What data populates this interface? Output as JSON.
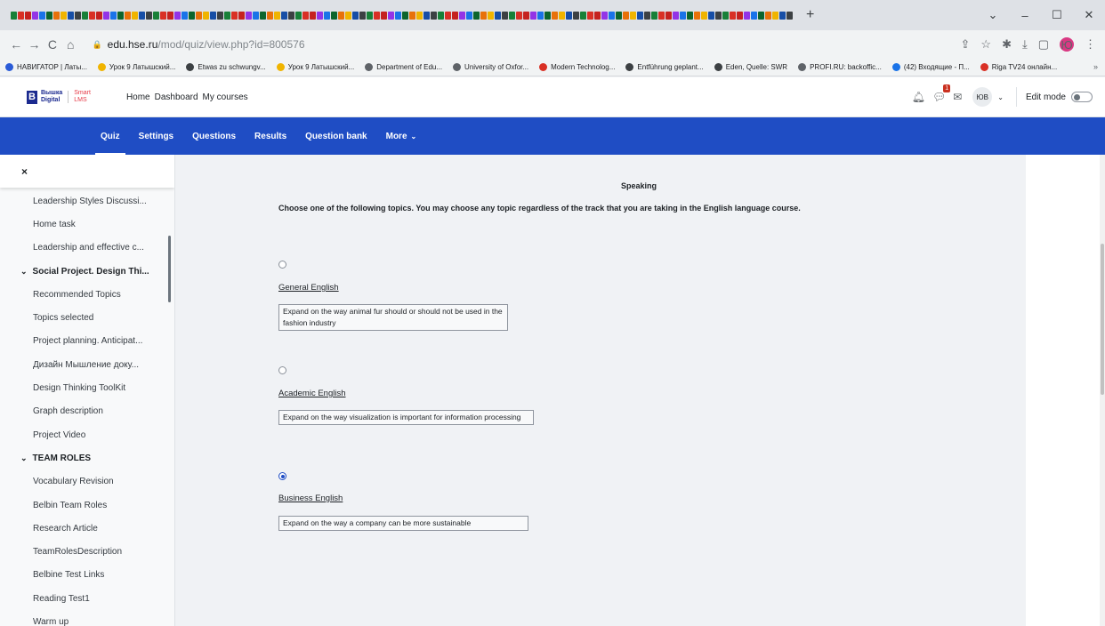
{
  "browser": {
    "new_tab": "+",
    "window_controls": [
      "⌄",
      "–",
      "☐",
      "✕"
    ],
    "nav": [
      "←",
      "→",
      "C",
      "⌂"
    ],
    "url_host": "edu.hse.ru",
    "url_path": "/mod/quiz/view.php?id=800576",
    "bookmarks": [
      {
        "label": "НАВИГАТОР | Латы...",
        "color": "#2a5bd7"
      },
      {
        "label": "Урок 9 Латышский...",
        "color": "#f0b400"
      },
      {
        "label": "Etwas zu schwungv...",
        "color": "#3c4043"
      },
      {
        "label": "Урок 9 Латышский...",
        "color": "#f0b400"
      },
      {
        "label": "Department of Edu...",
        "color": "#5f6368"
      },
      {
        "label": "University of Oxfor...",
        "color": "#5f6368"
      },
      {
        "label": "Modern Technolog...",
        "color": "#d93025"
      },
      {
        "label": "Entführung geplant...",
        "color": "#3c4043"
      },
      {
        "label": "Eden, Quelle: SWR",
        "color": "#3c4043"
      },
      {
        "label": "PROFI.RU: backoffic...",
        "color": "#5f6368"
      },
      {
        "label": "(42) Входящие - П...",
        "color": "#1a73e8"
      },
      {
        "label": "Riga TV24 онлайн...",
        "color": "#d93025"
      }
    ],
    "bookmarks_more": "»",
    "profile_initials": "Ю"
  },
  "header": {
    "logo_line1": "Вышка",
    "logo_line2": "Digital",
    "logo_smart": "Smart",
    "logo_lms": "LMS",
    "nav": [
      "Home",
      "Dashboard",
      "My courses"
    ],
    "message_badge": "1",
    "user_initials": "ЮВ",
    "edit_mode_label": "Edit mode"
  },
  "secondary_nav": {
    "tabs": [
      "Quiz",
      "Settings",
      "Questions",
      "Results",
      "Question bank",
      "More"
    ],
    "active_index": 0
  },
  "drawer": {
    "close": "×",
    "items": [
      {
        "label": "Leadership Styles Discussi...",
        "section": false
      },
      {
        "label": "Home task",
        "section": false
      },
      {
        "label": "Leadership and effective c...",
        "section": false
      },
      {
        "label": "Social Project. Design Thi...",
        "section": true
      },
      {
        "label": "Recommended Topics",
        "section": false
      },
      {
        "label": "Topics selected",
        "section": false
      },
      {
        "label": "Project planning. Anticipat...",
        "section": false
      },
      {
        "label": "Дизайн Мышление доку...",
        "section": false
      },
      {
        "label": "Design Thinking ToolKit",
        "section": false
      },
      {
        "label": "Graph description",
        "section": false
      },
      {
        "label": "Project Video",
        "section": false
      },
      {
        "label": "TEAM ROLES",
        "section": true
      },
      {
        "label": "Vocabulary Revision",
        "section": false
      },
      {
        "label": "Belbin Team Roles",
        "section": false
      },
      {
        "label": "Research Article",
        "section": false
      },
      {
        "label": "TeamRolesDescription",
        "section": false
      },
      {
        "label": "Belbine Test Links",
        "section": false
      },
      {
        "label": "Reading Test1",
        "section": false
      },
      {
        "label": "Warm up",
        "section": false
      }
    ]
  },
  "quiz": {
    "heading": "Speaking",
    "intro": "Choose one of the following topics. You may choose any topic regardless of the track that you are taking in the English language course.",
    "options": [
      {
        "title": "General English",
        "text": "Expand on the way animal fur should or should not  be used in the fashion industry",
        "selected": false
      },
      {
        "title": "Academic English",
        "text": "Expand on the way visualization is important for information processing",
        "selected": false
      },
      {
        "title": "Business English",
        "text": "Expand on the way a company can be more sustainable",
        "selected": true
      }
    ]
  },
  "colors": {
    "brand_blue": "#1f4dc4",
    "badge_red": "#ca3120"
  }
}
